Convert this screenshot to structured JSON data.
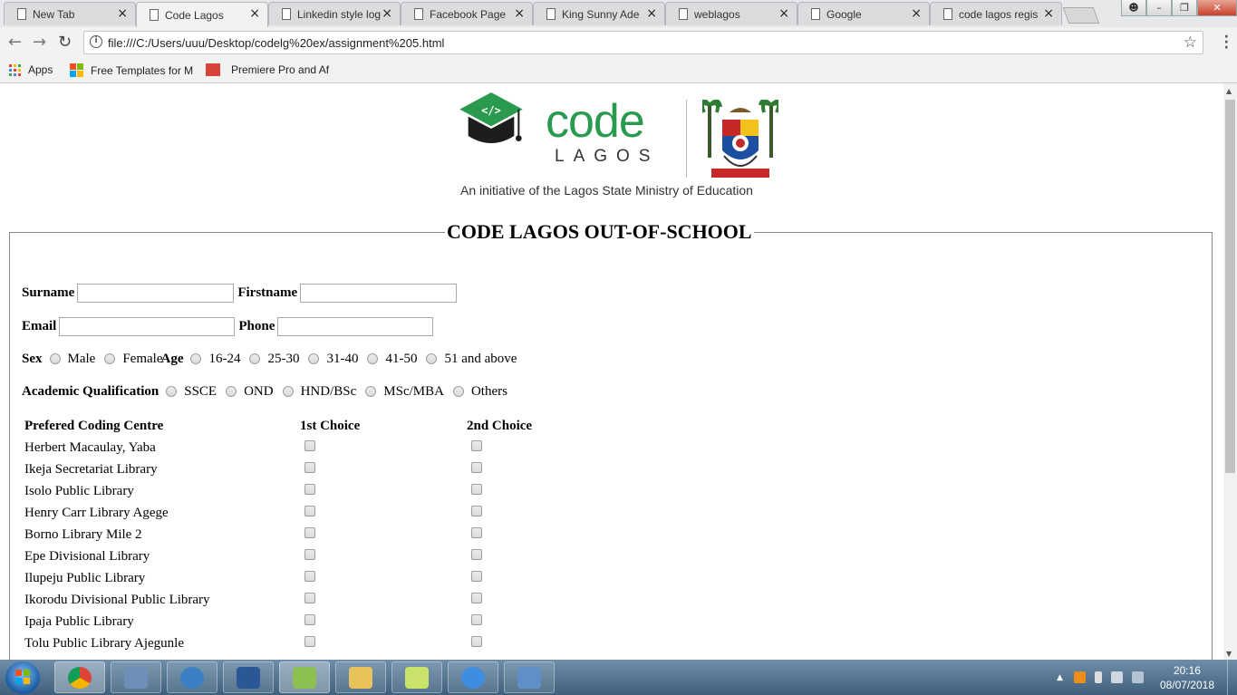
{
  "browser": {
    "tabs": [
      {
        "title": "New Tab",
        "active": false
      },
      {
        "title": "Code Lagos",
        "active": true
      },
      {
        "title": "Linkedin style log",
        "active": false
      },
      {
        "title": "Facebook Page",
        "active": false
      },
      {
        "title": "King Sunny Ade",
        "active": false
      },
      {
        "title": "weblagos",
        "active": false
      },
      {
        "title": "Google",
        "active": false
      },
      {
        "title": "code lagos regis",
        "active": false
      }
    ],
    "url": "file:///C:/Users/uuu/Desktop/codelg%20ex/assignment%205.html",
    "bookmarks": {
      "apps": "Apps",
      "free_templates": "Free Templates for M",
      "premiere": "Premiere Pro and Af"
    }
  },
  "logo": {
    "code": "code",
    "lagos": "LAGOS",
    "tagline": "An initiative of the Lagos State Ministry of Education"
  },
  "form": {
    "legend": "CODE LAGOS OUT-OF-SCHOOL",
    "surname_label": "Surname",
    "firstname_label": "Firstname",
    "email_label": "Email",
    "phone_label": "Phone",
    "sex_label": "Sex",
    "sex_options": [
      "Male",
      "Female"
    ],
    "age_label": "Age",
    "age_options": [
      "16-24",
      "25-30",
      "31-40",
      "41-50",
      "51 and above"
    ],
    "qualification_label": "Academic Qualification",
    "qualification_options": [
      "SSCE",
      "OND",
      "HND/BSc",
      "MSc/MBA",
      "Others"
    ],
    "centres_table": {
      "headers": [
        "Prefered Coding Centre",
        "1st Choice",
        "2nd Choice"
      ],
      "rows": [
        "Herbert Macaulay, Yaba",
        "Ikeja Secretariat Library",
        "Isolo Public Library",
        "Henry Carr Library Agege",
        "Borno Library Mile 2",
        "Epe Divisional Library",
        "Ilupeju Public Library",
        "Ikorodu Divisional Public Library",
        "Ipaja Public Library",
        "Tolu Public Library Ajegunle"
      ]
    }
  },
  "taskbar": {
    "time": "20:16",
    "date": "08/07/2018"
  },
  "colors": {
    "brand_green": "#2a9a4f",
    "taskbar": "#4f6f8c"
  }
}
